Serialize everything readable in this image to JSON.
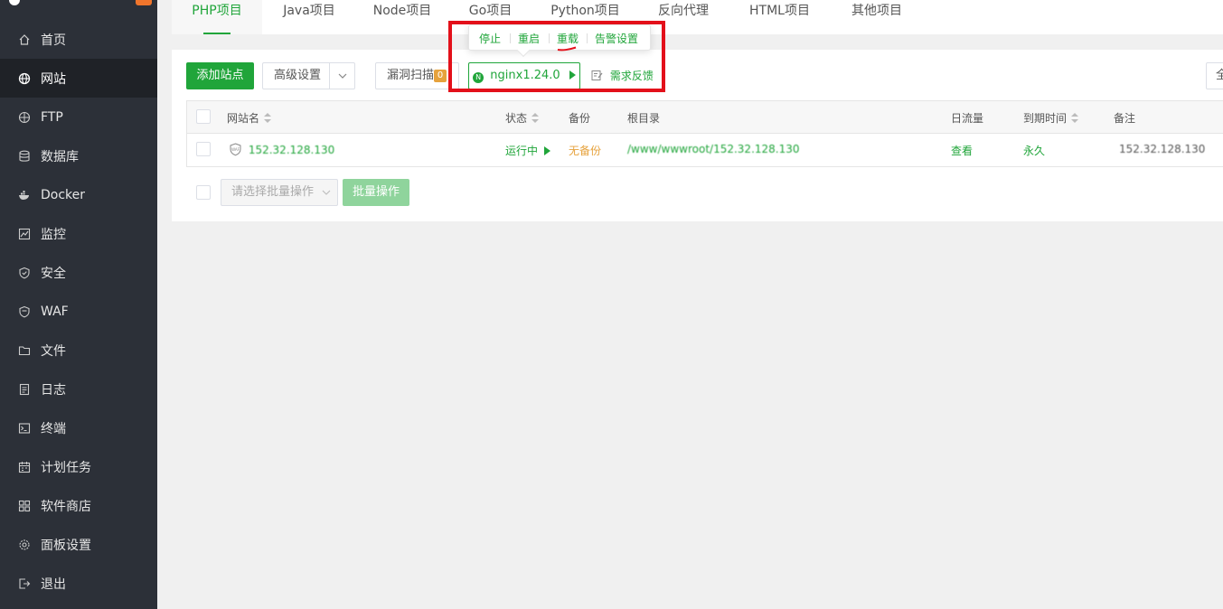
{
  "sidebar": {
    "items": [
      {
        "label": "首页",
        "icon": "home-icon"
      },
      {
        "label": "网站",
        "icon": "globe-icon"
      },
      {
        "label": "FTP",
        "icon": "ftp-globe-icon"
      },
      {
        "label": "数据库",
        "icon": "database-icon"
      },
      {
        "label": "Docker",
        "icon": "docker-icon"
      },
      {
        "label": "监控",
        "icon": "monitor-chart-icon"
      },
      {
        "label": "安全",
        "icon": "shield-check-icon"
      },
      {
        "label": "WAF",
        "icon": "waf-shield-icon"
      },
      {
        "label": "文件",
        "icon": "folder-icon"
      },
      {
        "label": "日志",
        "icon": "log-document-icon"
      },
      {
        "label": "终端",
        "icon": "terminal-icon"
      },
      {
        "label": "计划任务",
        "icon": "calendar-icon"
      },
      {
        "label": "软件商店",
        "icon": "app-grid-icon"
      },
      {
        "label": "面板设置",
        "icon": "gear-icon"
      },
      {
        "label": "退出",
        "icon": "logout-icon"
      }
    ],
    "active_label": "网站"
  },
  "tabs": [
    "PHP项目",
    "Java项目",
    "Node项目",
    "Go项目",
    "Python项目",
    "反向代理",
    "HTML项目",
    "其他项目"
  ],
  "active_tab": "PHP项目",
  "toolbar": {
    "add_site": "添加站点",
    "advanced": "高级设置",
    "vuln_scan": "漏洞扫描",
    "vuln_count": "0",
    "nginx": "nginx1.24.0",
    "feedback": "需求反馈",
    "right_partial": "全"
  },
  "popover": {
    "stop": "停止",
    "restart": "重启",
    "reload": "重载",
    "alert_settings": "告警设置"
  },
  "table": {
    "headers": {
      "name": "网站名",
      "status": "状态",
      "backup": "备份",
      "root": "根目录",
      "traffic": "日流量",
      "expire": "到期时间",
      "note": "备注"
    },
    "rows": [
      {
        "waf_badge": "WAF",
        "name": "152.32.128.130",
        "status": "运行中",
        "backup": "无备份",
        "root": "/www/wwwroot/152.32.128.130",
        "traffic": "查看",
        "expire": "永久",
        "note": "152.32.128.130"
      }
    ]
  },
  "batch": {
    "select_placeholder": "请选择批量操作",
    "button": "批量操作"
  },
  "colors": {
    "accent": "#20a53a",
    "sidebar_bg": "#2c3038",
    "highlight_box": "#e3101a",
    "warning": "#e6a23c"
  }
}
